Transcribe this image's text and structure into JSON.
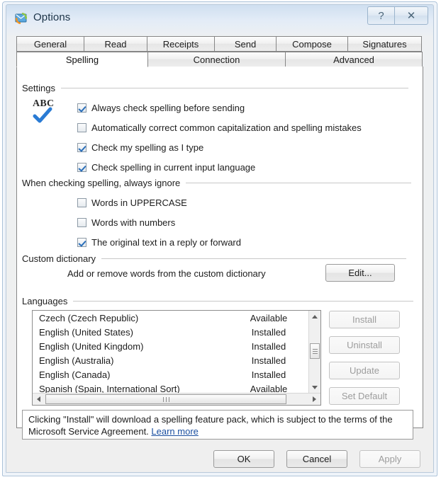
{
  "window": {
    "title": "Options",
    "icon": "mail-options-icon",
    "help_button": "?",
    "close_button": "✕"
  },
  "tabs": {
    "row1": [
      {
        "label": "General",
        "selected": false
      },
      {
        "label": "Read",
        "selected": false
      },
      {
        "label": "Receipts",
        "selected": false
      },
      {
        "label": "Send",
        "selected": false
      },
      {
        "label": "Compose",
        "selected": false
      },
      {
        "label": "Signatures",
        "selected": false
      }
    ],
    "row2": [
      {
        "label": "Spelling",
        "selected": true
      },
      {
        "label": "Connection",
        "selected": false
      },
      {
        "label": "Advanced",
        "selected": false
      }
    ]
  },
  "groups": {
    "settings": "Settings",
    "ignore": "When checking spelling, always ignore",
    "custom_dictionary": "Custom dictionary",
    "languages": "Languages"
  },
  "spell_icon": {
    "letters": "ABC",
    "check_color": "#2a7bd4"
  },
  "settings_options": [
    {
      "label": "Always check spelling before sending",
      "checked": true
    },
    {
      "label": "Automatically correct common capitalization and spelling mistakes",
      "checked": false
    },
    {
      "label": "Check my spelling as I type",
      "checked": true
    },
    {
      "label": "Check spelling in current input language",
      "checked": true
    }
  ],
  "ignore_options": [
    {
      "label": "Words in UPPERCASE",
      "checked": false
    },
    {
      "label": "Words with numbers",
      "checked": false
    },
    {
      "label": "The original text in a reply or forward",
      "checked": true
    }
  ],
  "custom_dictionary": {
    "description": "Add or remove words from the custom dictionary",
    "edit_button": "Edit..."
  },
  "languages": {
    "rows": [
      {
        "name": "Czech (Czech Republic)",
        "status": "Available"
      },
      {
        "name": "English (United States)",
        "status": "Installed"
      },
      {
        "name": "English (United Kingdom)",
        "status": "Installed"
      },
      {
        "name": "English (Australia)",
        "status": "Installed"
      },
      {
        "name": "English (Canada)",
        "status": "Installed"
      },
      {
        "name": "Spanish (Spain, International Sort)",
        "status": "Available"
      }
    ],
    "buttons": [
      {
        "label": "Install",
        "enabled": false
      },
      {
        "label": "Uninstall",
        "enabled": false
      },
      {
        "label": "Update",
        "enabled": false
      },
      {
        "label": "Set Default",
        "enabled": false
      }
    ]
  },
  "info": {
    "text": "Clicking \"Install\" will download a spelling feature pack, which is subject to the terms of the Microsoft Service Agreement. ",
    "link": "Learn more"
  },
  "dialog_buttons": [
    {
      "label": "OK",
      "enabled": true
    },
    {
      "label": "Cancel",
      "enabled": true
    },
    {
      "label": "Apply",
      "enabled": false
    }
  ],
  "colors": {
    "link": "#1b4fa0",
    "accent_check": "#2a6fba",
    "titlebar_top": "#cfdff0"
  }
}
